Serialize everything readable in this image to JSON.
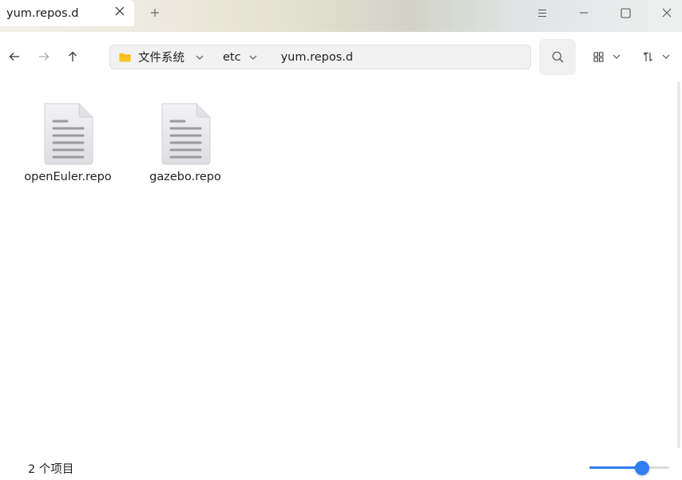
{
  "tab": {
    "title": "yum.repos.d"
  },
  "icons": {
    "tab_close": "close-icon",
    "new_tab": "plus-icon",
    "menu": "hamburger-menu-icon",
    "minimize": "minimize-icon",
    "maximize": "maximize-icon",
    "close": "close-icon",
    "back": "arrow-left-icon",
    "forward": "arrow-right-icon",
    "up": "arrow-up-icon",
    "search": "search-icon",
    "view_mode": "grid-view-icon",
    "sort": "sort-icon"
  },
  "breadcrumb": [
    {
      "label": "文件系统",
      "icon": "folder-icon"
    },
    {
      "label": "etc"
    },
    {
      "label": "yum.repos.d"
    }
  ],
  "files": [
    {
      "name": "openEuler.repo",
      "icon": "text-file-icon"
    },
    {
      "name": "gazebo.repo",
      "icon": "text-file-icon"
    }
  ],
  "status": {
    "item_count": "2 个项目"
  },
  "zoom": {
    "level_fraction": 0.66
  },
  "colors": {
    "accent": "#2f7ef2",
    "folder": "#f7c325"
  }
}
